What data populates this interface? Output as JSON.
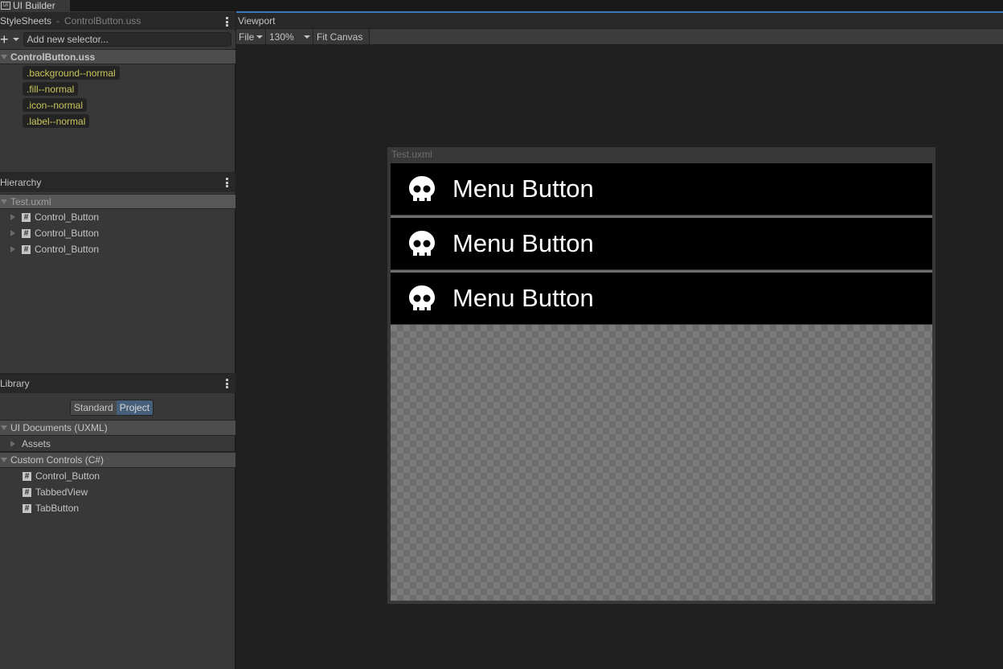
{
  "window": {
    "tab": "UI Builder",
    "tab_icon": "ui-icon"
  },
  "stylesheets": {
    "title": "StyleSheets",
    "separator": "-",
    "file": "ControlButton.uss",
    "selector_placeholder": "Add new selector...",
    "sheet": "ControlButton.uss",
    "selectors": [
      ".background--normal",
      ".fill--normal",
      ".icon--normal",
      ".label--normal"
    ]
  },
  "hierarchy": {
    "title": "Hierarchy",
    "root": "Test.uxml",
    "items": [
      "Control_Button",
      "Control_Button",
      "Control_Button"
    ]
  },
  "library": {
    "title": "Library",
    "tabs": [
      "Standard",
      "Project"
    ],
    "active_tab": "Project",
    "sections": [
      {
        "label": "UI Documents (UXML)",
        "items": [
          "Assets"
        ]
      },
      {
        "label": "Custom Controls (C#)",
        "items": [
          "Control_Button",
          "TabbedView",
          "TabButton"
        ]
      }
    ]
  },
  "viewport": {
    "title": "Viewport",
    "file_menu": "File",
    "zoom": "130%",
    "fit_canvas": "Fit Canvas",
    "document": "Test.uxml",
    "buttons": [
      "Menu Button",
      "Menu Button",
      "Menu Button"
    ]
  },
  "colors": {
    "accent": "#3a79bb",
    "selector": "#c8c55a",
    "project_tab": "#46607c"
  }
}
